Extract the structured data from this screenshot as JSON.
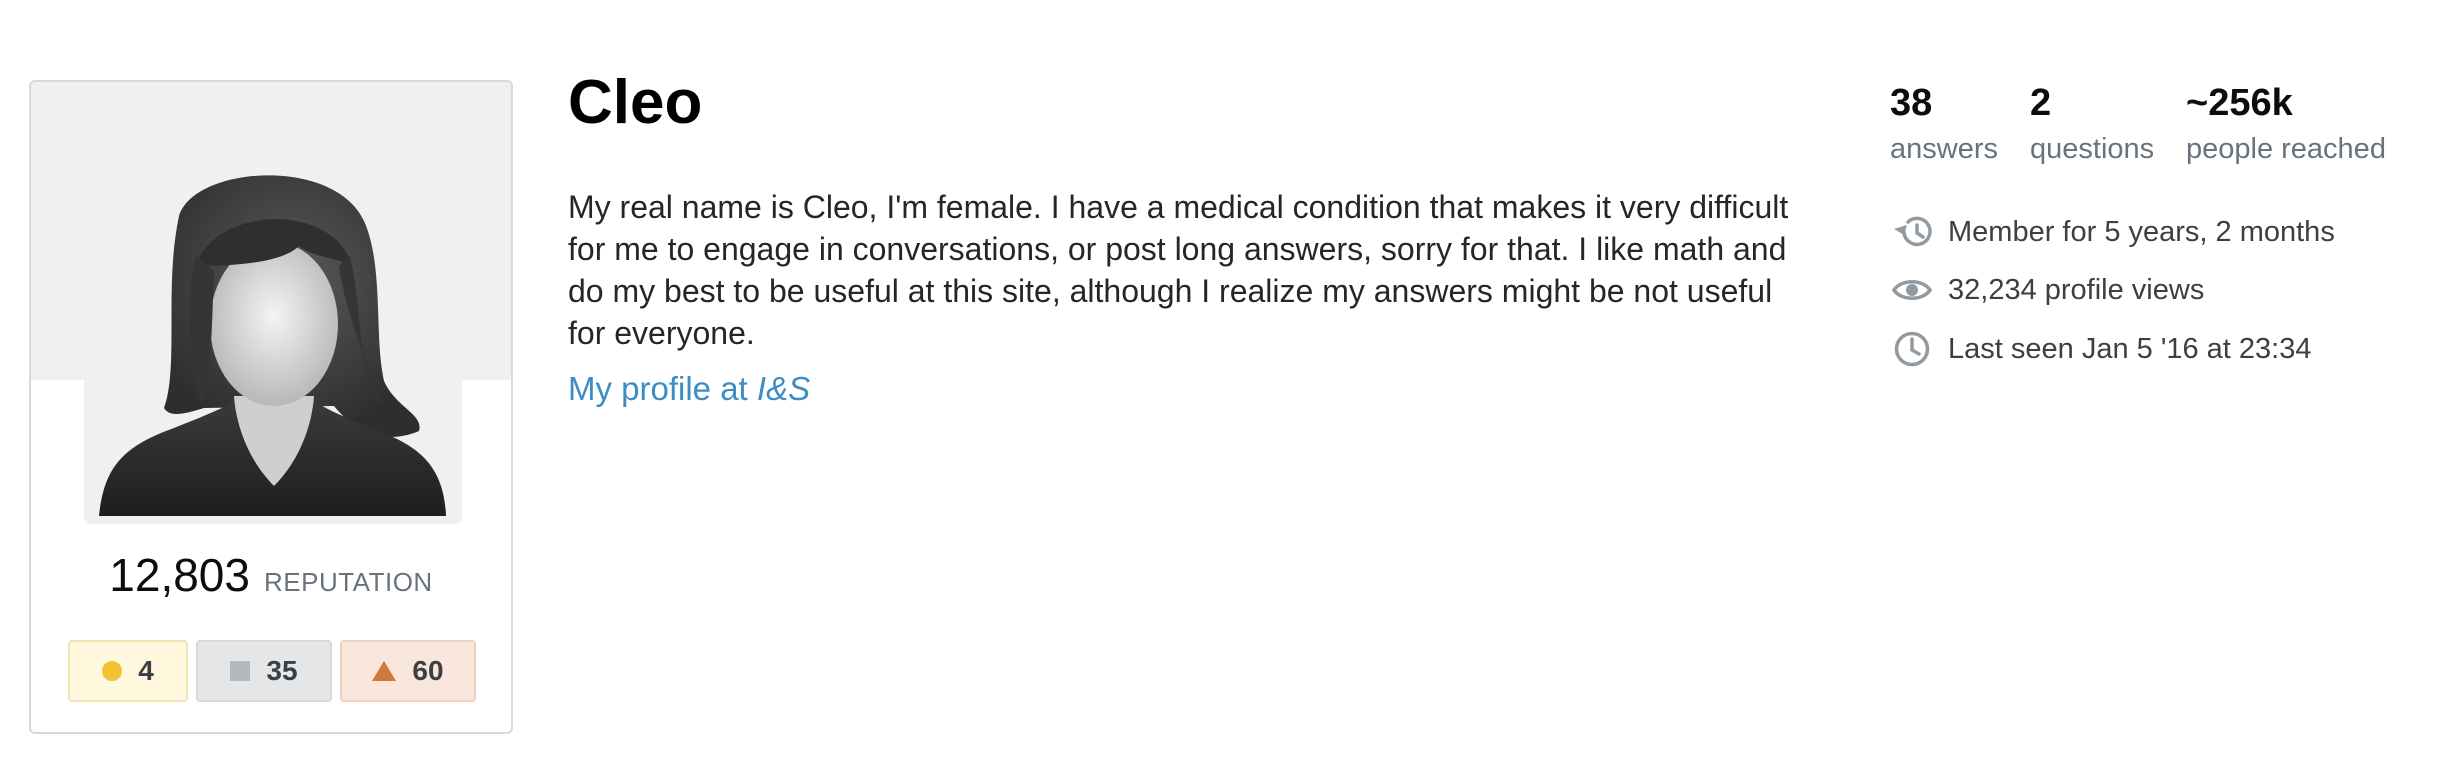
{
  "user": {
    "name": "Cleo",
    "bio": "My real name is Cleo, I'm female. I have a medical condition that makes it very difficult for me to engage in conversations, or post long answers, sorry for that. I like math and do my best to be useful at this site, although I realize my answers might be not useful for everyone.",
    "profile_link_prefix": "My profile at ",
    "profile_link_site": "I&S",
    "avatar_icon": "avatar-silhouette-icon"
  },
  "reputation": {
    "value": "12,803",
    "label": "REPUTATION"
  },
  "badges": [
    {
      "type": "gold",
      "count": "4",
      "color": "#f1c232"
    },
    {
      "type": "silver",
      "count": "35",
      "color": "#b4b8bc"
    },
    {
      "type": "bronze",
      "count": "60",
      "color": "#d1793b"
    }
  ],
  "stats": [
    {
      "value": "38",
      "label": "answers"
    },
    {
      "value": "2",
      "label": "questions"
    },
    {
      "value": "~256k",
      "label": "people reached"
    }
  ],
  "meta": [
    {
      "icon": "history-icon",
      "text": "Member for 5 years, 2 months"
    },
    {
      "icon": "eye-icon",
      "text": "32,234 profile views"
    },
    {
      "icon": "clock-icon",
      "text": "Last seen Jan 5 '16 at 23:34"
    }
  ],
  "colors": {
    "link": "#3d8dc5",
    "card_bg": "#eff0f1",
    "text": "#242729",
    "muted": "#6a737c"
  }
}
